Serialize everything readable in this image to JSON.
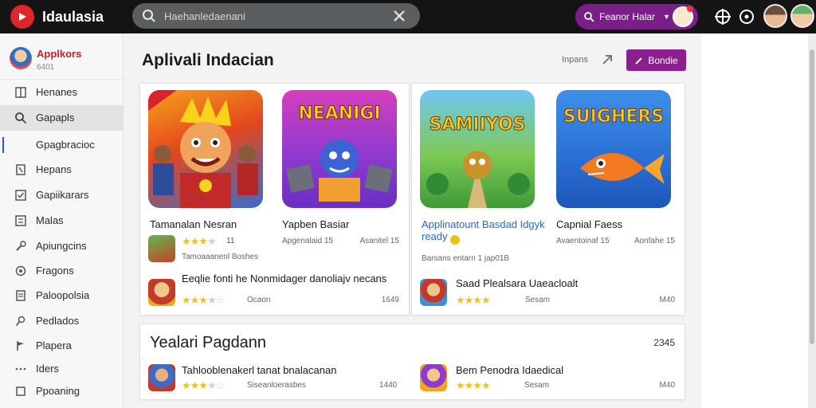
{
  "app": {
    "name": "Idaulasia"
  },
  "colors": {
    "brand": "#e0262b",
    "accent": "#8a1f8d",
    "star": "#f2bf1d",
    "link": "#2569c7"
  },
  "search": {
    "placeholder": "Haehanledaenani"
  },
  "promo": {
    "label": "Feanor Halar",
    "icon": "search-icon"
  },
  "profile": {
    "name": "Applkors",
    "sub": "6401"
  },
  "sidebar": {
    "items": [
      {
        "label": "Henanes",
        "icon": "grid-icon"
      },
      {
        "label": "Gapapls",
        "icon": "search-icon"
      },
      {
        "label": "Gpagbracioc",
        "icon": "none"
      },
      {
        "label": "Hepans",
        "icon": "bookmark-icon"
      },
      {
        "label": "Gapiikarars",
        "icon": "checkbox-icon"
      },
      {
        "label": "Malas",
        "icon": "list-icon"
      },
      {
        "label": "Apiungcins",
        "icon": "wrench-icon"
      },
      {
        "label": "Fragons",
        "icon": "gear-icon"
      },
      {
        "label": "Paloopolsia",
        "icon": "document-icon"
      },
      {
        "label": "Pedlados",
        "icon": "pin-icon"
      },
      {
        "label": "Plapera",
        "icon": "flag-icon"
      },
      {
        "label": "Iders",
        "icon": "dots-icon"
      },
      {
        "label": "Ppoaning",
        "icon": "square-icon"
      }
    ]
  },
  "main": {
    "title": "Aplivali Indacian",
    "sort_label": "Inpans",
    "cta_label": "Bondie",
    "card1": {
      "tiles": [
        {
          "art_text": "",
          "title": "Tamanalan Nesran",
          "rating": "11",
          "right": "",
          "meta": "Tamoaaanenl Boshes",
          "style": "blue",
          "stars": 3
        },
        {
          "art_text": "NEANIGI",
          "title": "Yapben Basiar",
          "rating": "",
          "right": "Asanitel 15",
          "meta": "Apgenalaid 15",
          "style": "purple",
          "stars": 0
        }
      ],
      "row": {
        "title": "Eeqlie fonti he Nonmidager danoliajv necans",
        "stars": 3.5,
        "meta": "Ocaon",
        "right": "1649"
      }
    },
    "card2": {
      "tiles": [
        {
          "art_text": "SAMIIYOS",
          "title": "Applinatount Basdad Idgyk",
          "title2": "ready",
          "rating": "",
          "right": "",
          "meta": "Barsans entarn 1 jap01B",
          "style": "green",
          "stars": 0
        },
        {
          "art_text": "SUIGHERS",
          "title": "Capnial Faess",
          "rating": "",
          "right": "Aonfahe 15",
          "meta": "Avaentoinaf 15",
          "style": "sky",
          "stars": 0
        }
      ],
      "row": {
        "title": "Saad Plealsara Uaeacloalt",
        "stars": 4,
        "meta": "Sesam",
        "right": "M40"
      }
    },
    "section2": {
      "title": "Yealari Pagdann",
      "count": "2345",
      "rows": [
        {
          "title": "Tahlooblenakerl tanat bnalacanan",
          "stars": 3.5,
          "meta": "Siseanloerasbes",
          "right": "1440"
        },
        {
          "title": "Bem Penodra Idaedical",
          "stars": 4,
          "meta": "Sesam",
          "right": "M40"
        }
      ]
    }
  }
}
